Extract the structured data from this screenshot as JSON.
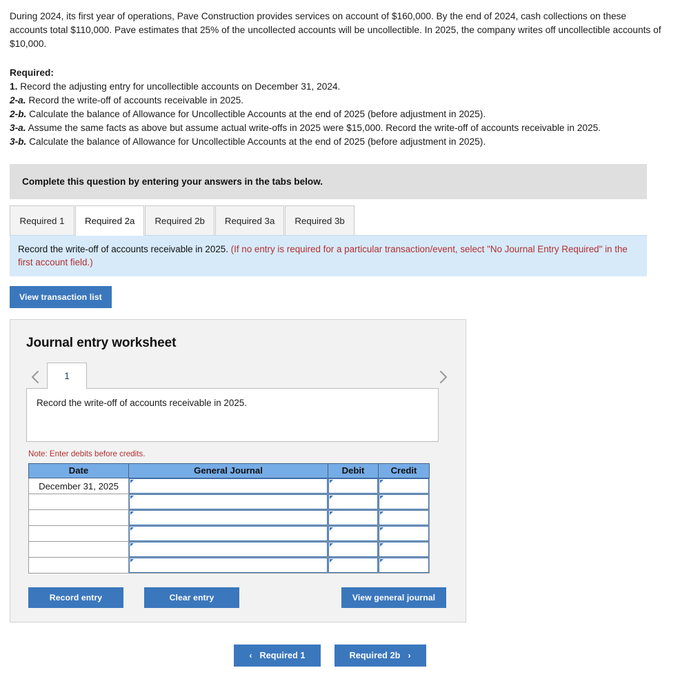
{
  "problem": {
    "paragraph": "During 2024, its first year of operations, Pave Construction provides services on account of $160,000. By the end of 2024, cash collections on these accounts total $110,000. Pave estimates that 25% of the uncollected accounts will be uncollectible. In 2025, the company writes off uncollectible accounts of $10,000."
  },
  "required": {
    "heading": "Required:",
    "items": [
      {
        "label": "1.",
        "text": "Record the adjusting entry for uncollectible accounts on December 31, 2024."
      },
      {
        "label": "2-a.",
        "text": "Record the write-off of accounts receivable in 2025."
      },
      {
        "label": "2-b.",
        "text": "Calculate the balance of Allowance for Uncollectible Accounts at the end of 2025 (before adjustment in 2025)."
      },
      {
        "label": "3-a.",
        "text": "Assume the same facts as above but assume actual write-offs in 2025 were $15,000. Record the write-off of accounts receivable in 2025."
      },
      {
        "label": "3-b.",
        "text": "Calculate the balance of Allowance for Uncollectible Accounts at the end of 2025 (before adjustment in 2025)."
      }
    ]
  },
  "gray_banner": {
    "text": "Complete this question by entering your answers in the tabs below."
  },
  "tabs": [
    {
      "label": "Required 1",
      "active": false
    },
    {
      "label": "Required 2a",
      "active": true
    },
    {
      "label": "Required 2b",
      "active": false
    },
    {
      "label": "Required 3a",
      "active": false
    },
    {
      "label": "Required 3b",
      "active": false
    }
  ],
  "blue_strip": {
    "prompt": "Record the write-off of accounts receivable in 2025.",
    "hint": "(If no entry is required for a particular transaction/event, select \"No Journal Entry Required\" in the first account field.)"
  },
  "view_transaction_list_label": "View transaction list",
  "worksheet": {
    "title": "Journal entry worksheet",
    "prev_icon": "chevron-left-icon",
    "next_icon": "chevron-right-icon",
    "page_number": "1",
    "description": "Record the write-off of accounts receivable in 2025.",
    "note": "Note: Enter debits before credits.",
    "table": {
      "headers": [
        "Date",
        "General Journal",
        "Debit",
        "Credit"
      ],
      "rows": [
        {
          "date": "December 31, 2025",
          "general_journal": "",
          "debit": "",
          "credit": ""
        },
        {
          "date": "",
          "general_journal": "",
          "debit": "",
          "credit": ""
        },
        {
          "date": "",
          "general_journal": "",
          "debit": "",
          "credit": ""
        },
        {
          "date": "",
          "general_journal": "",
          "debit": "",
          "credit": ""
        },
        {
          "date": "",
          "general_journal": "",
          "debit": "",
          "credit": ""
        },
        {
          "date": "",
          "general_journal": "",
          "debit": "",
          "credit": ""
        }
      ]
    },
    "actions": {
      "record_entry": "Record entry",
      "clear_entry": "Clear entry",
      "view_general_journal": "View general journal"
    }
  },
  "bottom_nav": {
    "prev_arrow": "‹",
    "prev_label": "Required 1",
    "next_label": "Required 2b",
    "next_arrow": "›"
  },
  "colors": {
    "accent_blue": "#3b77bd",
    "table_header_blue": "#76ace6",
    "info_strip_blue": "#d7eafa",
    "gray_banner": "#dfdfdf",
    "panel_gray": "#f2f2f2",
    "note_red": "#b03030"
  }
}
